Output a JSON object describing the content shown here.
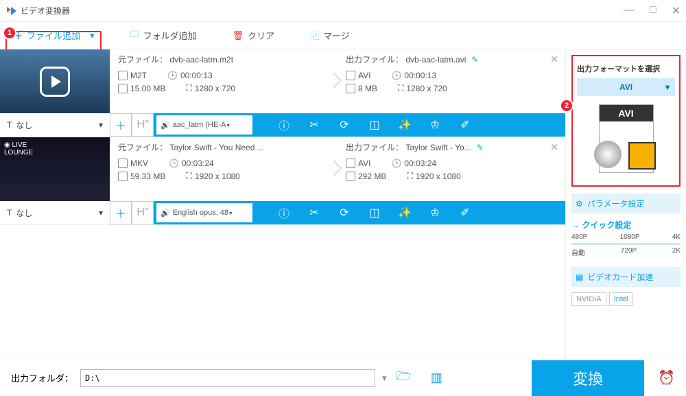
{
  "window": {
    "title": "ビデオ変換器"
  },
  "toolbar": {
    "add_file": "ファイル追加",
    "add_folder": "フォルダ追加",
    "clear": "クリア",
    "merge": "マージ"
  },
  "files": [
    {
      "src": {
        "label": "元ファイル：",
        "name": "dvb-aac-latm.m2t",
        "container": "M2T",
        "duration": "00:00:13",
        "size": "15.00 MB",
        "resolution": "1280 x 720"
      },
      "dst": {
        "label": "出力ファイル：",
        "name": "dvb-aac-latm.avi",
        "container": "AVI",
        "duration": "00:00:13",
        "size": "8 MB",
        "resolution": "1280 x 720"
      },
      "subtitle": "なし",
      "audio": "aac_latm (HE-A"
    },
    {
      "src": {
        "label": "元ファイル：",
        "name": "Taylor Swift - You Need ...",
        "container": "MKV",
        "duration": "00:03:24",
        "size": "59.33 MB",
        "resolution": "1920 x 1080"
      },
      "dst": {
        "label": "出力ファイル：",
        "name": "Taylor Swift - Yo...",
        "container": "AVI",
        "duration": "00:03:24",
        "size": "292 MB",
        "resolution": "1920 x 1080"
      },
      "subtitle": "なし",
      "audio": "English opus, 48"
    }
  ],
  "sidebar": {
    "format_title": "出力フォーマットを選択",
    "format_selected": "AVI",
    "format_badge": "AVI",
    "param_settings": "パラメータ設定",
    "quick_settings": "クイック設定",
    "resolutions_top": [
      "480P",
      "1080P",
      "4K"
    ],
    "resolutions_bottom": [
      "自動",
      "720P",
      "2K"
    ],
    "gpu_accel": "ビデオカード加速",
    "gpu_nvidia": "NVIDIA",
    "gpu_intel": "Intel"
  },
  "footer": {
    "label": "出力フォルダ：",
    "path": "D:\\",
    "convert": "変換"
  }
}
